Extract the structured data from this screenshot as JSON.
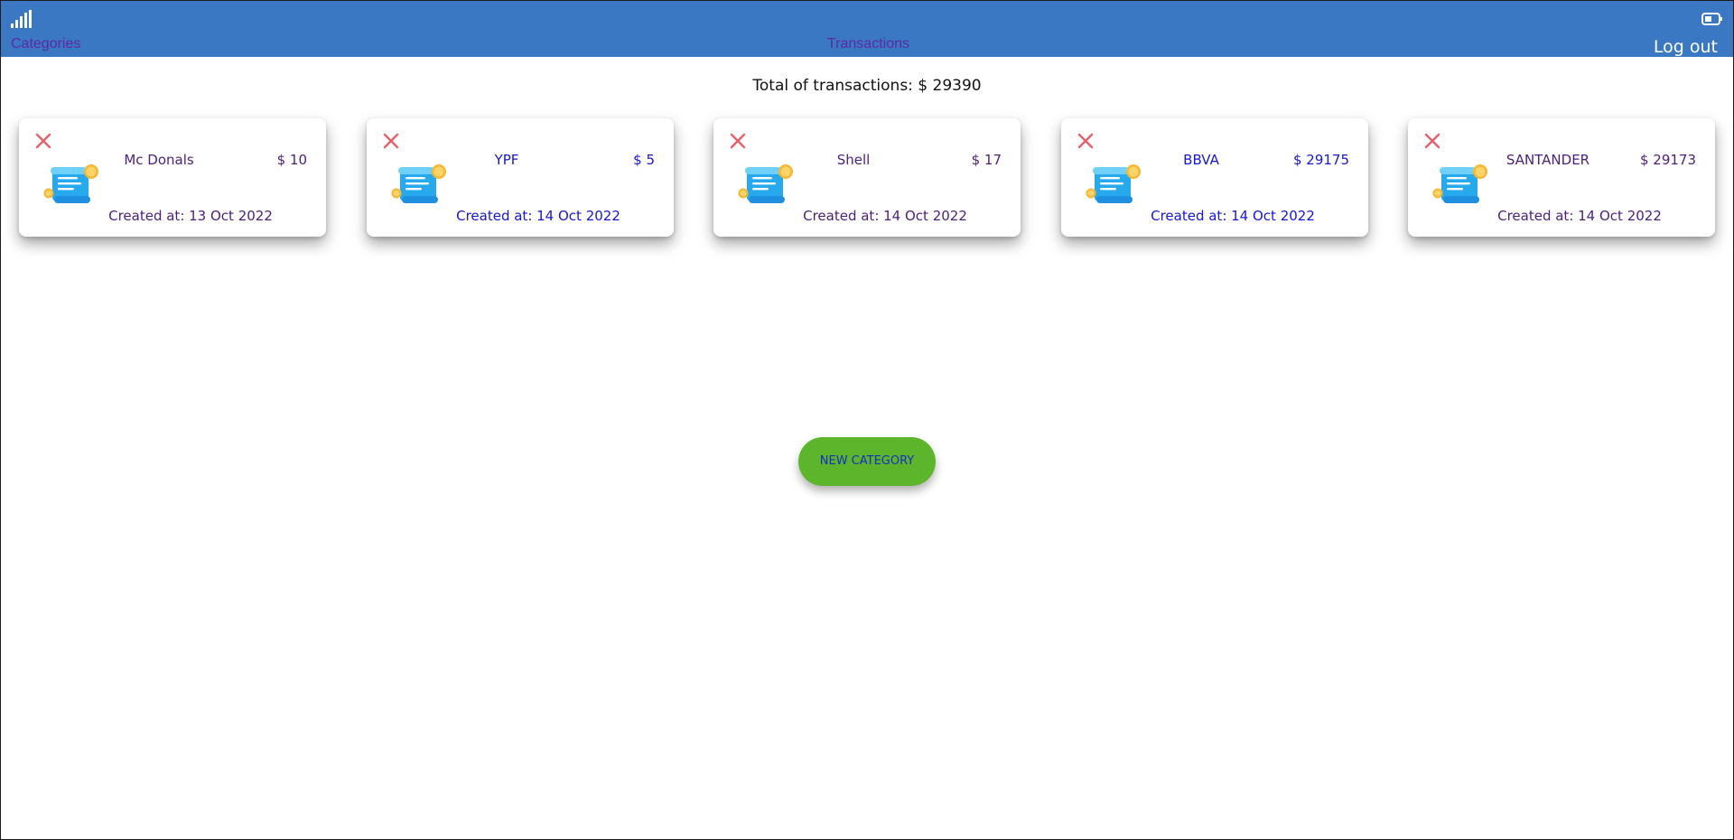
{
  "nav": {
    "categories_label": "Categories",
    "transactions_label": "Transactions",
    "logout_label": "Log out"
  },
  "total": {
    "text": "Total of transactions: $ 29390"
  },
  "cards": [
    {
      "name": "Mc Donals",
      "amount": "$ 10",
      "created": "Created at: 13 Oct 2022"
    },
    {
      "name": "YPF",
      "amount": "$ 5",
      "created": "Created at: 14 Oct 2022"
    },
    {
      "name": "Shell",
      "amount": "$ 17",
      "created": "Created at: 14 Oct 2022"
    },
    {
      "name": "BBVA",
      "amount": "$ 29175",
      "created": "Created at: 14 Oct 2022"
    },
    {
      "name": "SANTANDER",
      "amount": "$ 29173",
      "created": "Created at: 14 Oct 2022"
    }
  ],
  "actions": {
    "new_category_label": "NEW CATEGORY"
  },
  "icons": {
    "status_signal": "signal-icon",
    "status_battery": "battery-icon",
    "card_delete": "close-icon",
    "card_image": "receipt-icon"
  },
  "colors": {
    "topbar": "#3a78c3",
    "nav_link": "#5b2aa3",
    "delete_x": "#e8606a",
    "button_bg": "#5db52b",
    "button_text": "#1530c2",
    "text_purple": "#4b1f7a",
    "text_blue": "#1616d4"
  }
}
